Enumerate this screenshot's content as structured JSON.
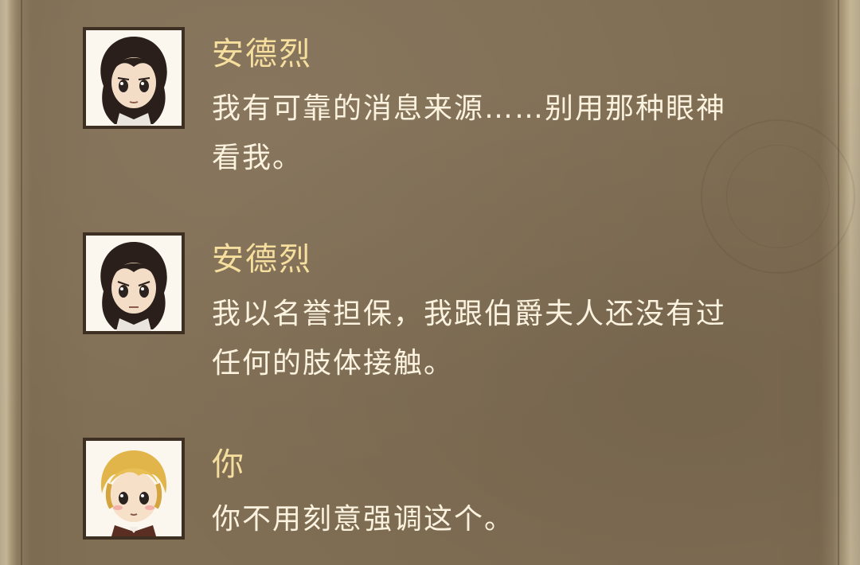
{
  "dialog": [
    {
      "speaker": "安德烈",
      "avatar_icon": "dark-haired-man-portrait-icon",
      "text": "我有可靠的消息来源……别用那种眼神\n看我。"
    },
    {
      "speaker": "安德烈",
      "avatar_icon": "dark-haired-man-portrait-icon",
      "text": "我以名誉担保，我跟伯爵夫人还没有过\n任何的肢体接触。"
    },
    {
      "speaker": "你",
      "avatar_icon": "blonde-person-portrait-icon",
      "text": "你不用刻意强调这个。"
    }
  ],
  "colors": {
    "speaker_name": "#f6df9e",
    "dialog_text": "#fbf3df",
    "parchment": "#806e54"
  }
}
